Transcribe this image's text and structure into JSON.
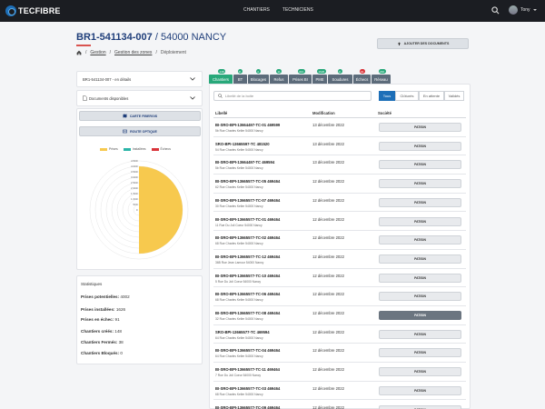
{
  "app": {
    "logo_text": "TECFIBRE"
  },
  "topnav": {
    "items": [
      "CHANTIERS",
      "TECHNICIENS"
    ]
  },
  "user": {
    "name": "Tony"
  },
  "header": {
    "title_ref": "BR1-541134-007",
    "title_suffix": " / 54000 NANCY"
  },
  "breadcrumb": {
    "items": [
      "Gestion",
      "Gestion des zones",
      "Déploiement"
    ]
  },
  "add_docs_label": "AJOUTER DES DOCUMENTS",
  "left": {
    "zone_select": "BR1-541134-007 - en détails",
    "docs_select": "Documents disponibles",
    "btn_carte": "CARTE FIBERGIS",
    "btn_route": "ROUTE OPTIQUE"
  },
  "chart_data": {
    "type": "radar",
    "categories": [
      "Prises",
      "Installées",
      "Échecs"
    ],
    "series": [
      {
        "name": "Prises",
        "color": "#f7c94e",
        "values": [
          4002,
          4002,
          4002
        ]
      },
      {
        "name": "Installées",
        "color": "#2bb5a8",
        "values": [
          1626
        ]
      },
      {
        "name": "Échecs",
        "color": "#d9343a",
        "values": [
          91
        ]
      }
    ],
    "tick_labels": [
      "0",
      "500",
      "1 000",
      "1 500",
      "2 000",
      "2 500",
      "3 000",
      "3 500",
      "4 000",
      "4 500"
    ],
    "rmax": 4500
  },
  "stats": {
    "title": "Statistiques",
    "items": [
      {
        "label": "Prises potentielles:",
        "value": "4002"
      },
      {
        "label": "Prises installées:",
        "value": "1626"
      },
      {
        "label": "Prises en échec:",
        "value": "91"
      },
      {
        "label": "Chantiers créés:",
        "value": "148"
      },
      {
        "label": "Chantiers Fermés:",
        "value": "38"
      },
      {
        "label": "Chantiers Bloqués:",
        "value": "0"
      }
    ]
  },
  "tabs": [
    {
      "label": "Chantiers",
      "badge": "148",
      "badge_color": "#28a87a"
    },
    {
      "label": "BT",
      "badge": "8",
      "badge_color": "#28a87a"
    },
    {
      "label": "Blocages",
      "badge": "4",
      "badge_color": "#28a87a"
    },
    {
      "label": "Refus",
      "badge": "11",
      "badge_color": "#28a87a"
    },
    {
      "label": "Prises BI",
      "badge": "324",
      "badge_color": "#28a87a"
    },
    {
      "label": "PME",
      "badge": "1626",
      "badge_color": "#28a87a"
    },
    {
      "label": "Soudures",
      "badge": "0",
      "badge_color": "#28a87a"
    },
    {
      "label": "Échecs",
      "badge": "91",
      "badge_color": "#d9343a"
    },
    {
      "label": "Réseau",
      "badge": "230",
      "badge_color": "#28a87a"
    }
  ],
  "search": {
    "placeholder": "Libellé de la boite"
  },
  "filters": [
    "Tous",
    "Clôturés",
    "En attente",
    "Validés"
  ],
  "table": {
    "headers": [
      "Libellé",
      "Modification",
      "Société"
    ],
    "rows": [
      {
        "ref": "BI-SRO-BPI-13664497-TC-01 469599",
        "addr": "5b Rue Charles Keller 54000 Nancy",
        "date": "13 décembre 2022",
        "soc": "PATISIN",
        "highlight": false
      },
      {
        "ref": "SRO-BPI-13665597-TC 481520",
        "addr": "54 Rue Charles Keller 54000 Nancy",
        "date": "13 décembre 2022",
        "soc": "PATISIN",
        "highlight": false
      },
      {
        "ref": "BI-SRO-BPI-13664497-TC 469594",
        "addr": "5b Rue Charles Keller 54000 Nancy",
        "date": "13 décembre 2022",
        "soc": "PATISIN",
        "highlight": false
      },
      {
        "ref": "BI-SRO-BPI-13665577-TC-05 469464",
        "addr": "62 Rue Charles Keller 54000 Nancy",
        "date": "12 décembre 2022",
        "soc": "PATISIN",
        "highlight": false
      },
      {
        "ref": "BI-SRO-BPI-13665577-TC-07 469464",
        "addr": "30 Rue Charles Keller 54000 Nancy",
        "date": "12 décembre 2022",
        "soc": "PATISIN",
        "highlight": false
      },
      {
        "ref": "BI-SRO-BPI-13665577-TC-01 469464",
        "addr": "11 Rue Du Joli Coeur 54000 Nancy",
        "date": "12 décembre 2022",
        "soc": "PATISIN",
        "highlight": false
      },
      {
        "ref": "BI-SRO-BPI-13665577-TC-02 469464",
        "addr": "68 Rue Charles Keller 54000 Nancy",
        "date": "12 décembre 2022",
        "soc": "PATISIN",
        "highlight": false
      },
      {
        "ref": "BI-SRO-BPI-13665577-TC-12 469464",
        "addr": "36B Rue Jean Lamour 54000 Nancy",
        "date": "12 décembre 2022",
        "soc": "PATISIN",
        "highlight": false
      },
      {
        "ref": "BI-SRO-BPI-13665577-TC-10 469464",
        "addr": "5 Rue Du Joli Coeur 54000 Nancy",
        "date": "12 décembre 2022",
        "soc": "PATISIN",
        "highlight": false
      },
      {
        "ref": "BI-SRO-BPI-13665577-TC-06 469464",
        "addr": "68 Rue Charles Keller 54000 Nancy",
        "date": "12 décembre 2022",
        "soc": "PATISIN",
        "highlight": false
      },
      {
        "ref": "BI-SRO-BPI-13665577-TC-08 469464",
        "addr": "32 Rue Charles Keller 54000 Nancy",
        "date": "12 décembre 2022",
        "soc": "PATISIN",
        "highlight": true
      },
      {
        "ref": "SRO-BPI-13665577-TC 469594",
        "addr": "64 Rue Charles Keller 54000 Nancy",
        "date": "12 décembre 2022",
        "soc": "PATISIN",
        "highlight": false
      },
      {
        "ref": "BI-SRO-BPI-13665577-TC-04 469464",
        "addr": "64 Rue Charles Keller 54000 Nancy",
        "date": "12 décembre 2022",
        "soc": "PATISIN",
        "highlight": false
      },
      {
        "ref": "BI-SRO-BPI-13665577-TC-11 469464",
        "addr": "7 Rue Du Joli Coeur 54000 Nancy",
        "date": "12 décembre 2022",
        "soc": "PATISIN",
        "highlight": false
      },
      {
        "ref": "BI-SRO-BPI-13665577-TC-03 469464",
        "addr": "68 Rue Charles Keller 54000 Nancy",
        "date": "12 décembre 2022",
        "soc": "PATISIN",
        "highlight": false
      },
      {
        "ref": "BI-SRO-BPI-13665577-TC-09 469464",
        "addr": "68 Rue Charles Keller 54000 Nancy",
        "date": "12 décembre 2022",
        "soc": "PATISIN",
        "highlight": false
      }
    ]
  }
}
